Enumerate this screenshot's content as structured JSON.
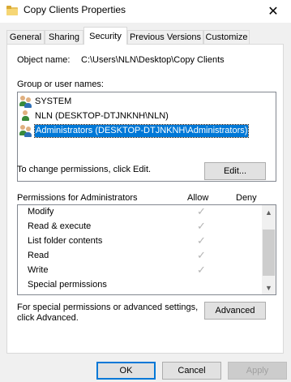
{
  "window": {
    "title": "Copy Clients Properties",
    "close_glyph": "✕"
  },
  "tabs": [
    {
      "label": "General"
    },
    {
      "label": "Sharing"
    },
    {
      "label": "Security"
    },
    {
      "label": "Previous Versions"
    },
    {
      "label": "Customize"
    }
  ],
  "active_tab": "Security",
  "object": {
    "label": "Object name:",
    "value": "C:\\Users\\NLN\\Desktop\\Copy Clients"
  },
  "groups": {
    "label": "Group or user names:",
    "items": [
      {
        "name": "SYSTEM",
        "icon": "users-group-icon"
      },
      {
        "name": "NLN (DESKTOP-DTJNKNH\\NLN)",
        "icon": "user-icon"
      },
      {
        "name": "Administrators (DESKTOP-DTJNKNH\\Administrators)",
        "icon": "users-group-icon",
        "selected": true
      }
    ]
  },
  "edit": {
    "hint": "To change permissions, click Edit.",
    "button": "Edit..."
  },
  "permissions": {
    "label": "Permissions for Administrators",
    "allow_label": "Allow",
    "deny_label": "Deny",
    "check_glyph": "✓",
    "rows": [
      {
        "name": "Modify",
        "allow": true,
        "deny": false
      },
      {
        "name": "Read & execute",
        "allow": true,
        "deny": false
      },
      {
        "name": "List folder contents",
        "allow": true,
        "deny": false
      },
      {
        "name": "Read",
        "allow": true,
        "deny": false
      },
      {
        "name": "Write",
        "allow": true,
        "deny": false
      },
      {
        "name": "Special permissions",
        "allow": false,
        "deny": false
      }
    ],
    "scroll_up_glyph": "▲",
    "scroll_down_glyph": "▼"
  },
  "advanced": {
    "hint_line1": "For special permissions or advanced settings,",
    "hint_line2": "click Advanced.",
    "button": "Advanced"
  },
  "footer": {
    "ok": "OK",
    "cancel": "Cancel",
    "apply": "Apply"
  },
  "colors": {
    "selection": "#0078d7",
    "disabled_text": "#a0a0a0",
    "check_disabled": "#b3b3b3"
  }
}
